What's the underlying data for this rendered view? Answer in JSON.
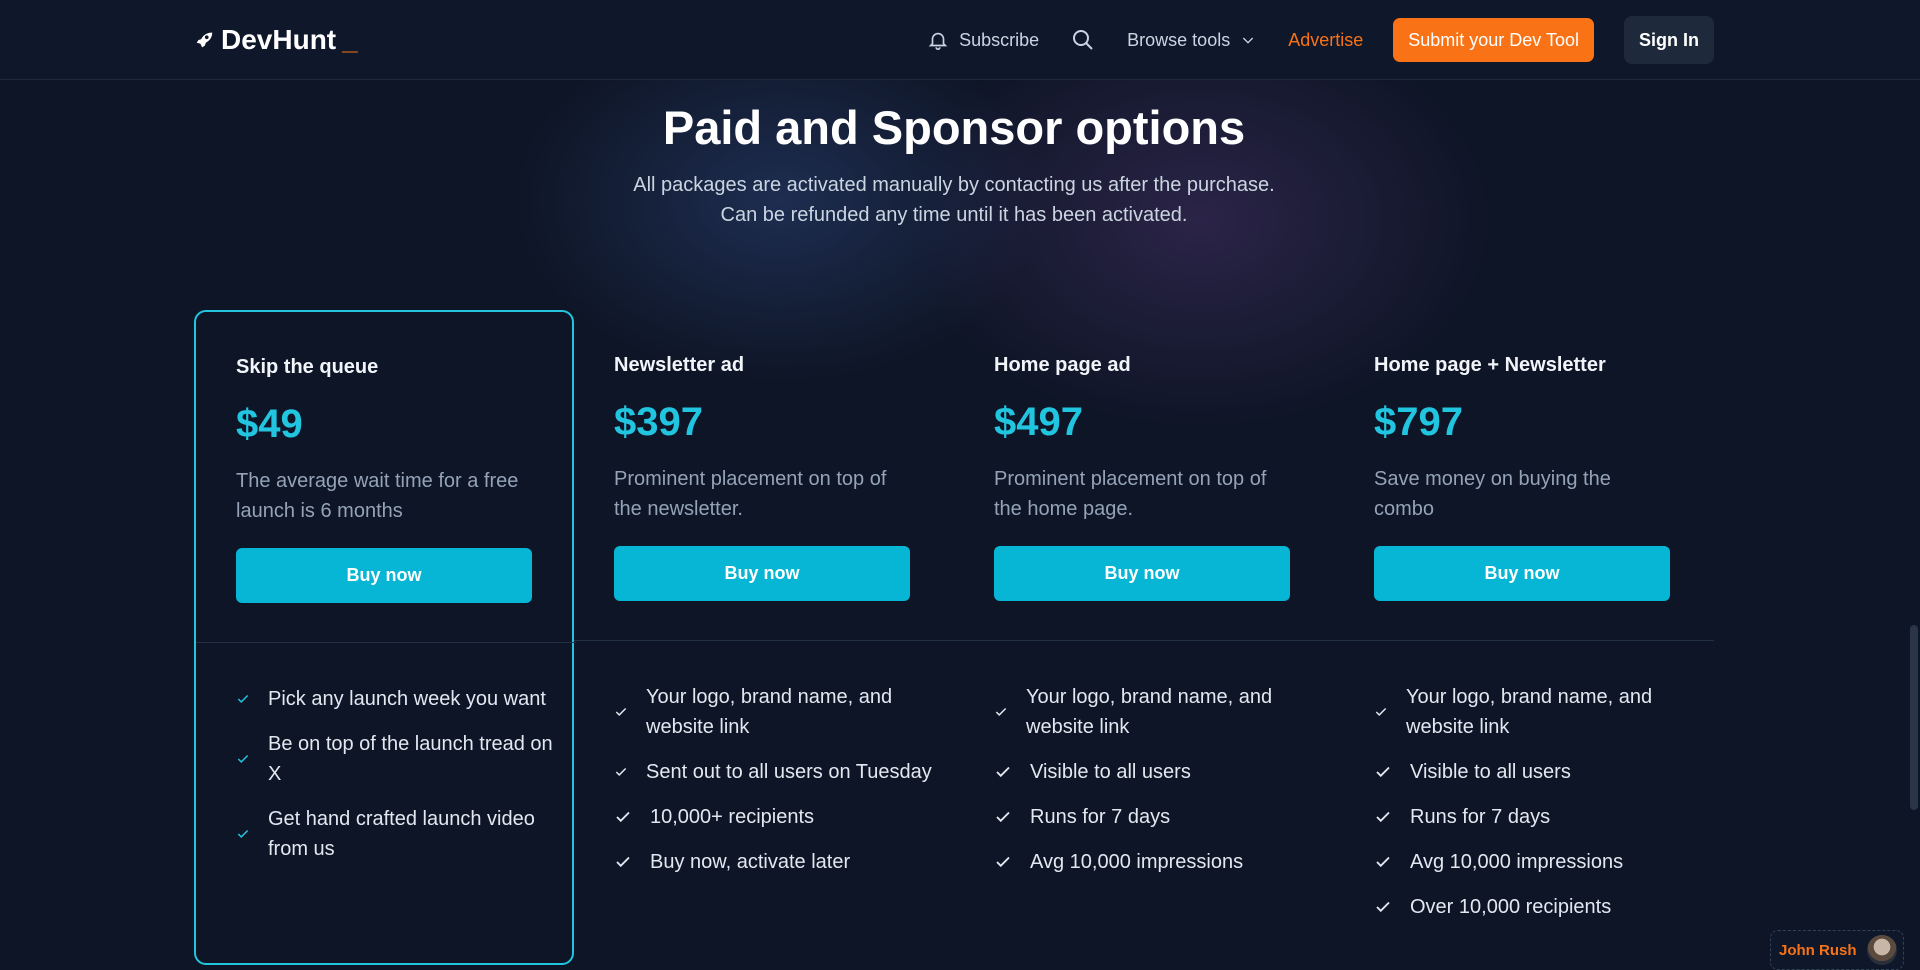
{
  "header": {
    "logo_text": "DevHunt",
    "logo_cursor": "_",
    "nav": {
      "subscribe": "Subscribe",
      "browse": "Browse tools",
      "advertise": "Advertise",
      "submit": "Submit your Dev Tool",
      "signin": "Sign In"
    }
  },
  "hero": {
    "title": "Paid and Sponsor options",
    "subtitle_line1": "All packages are activated manually by contacting us after the purchase.",
    "subtitle_line2": "Can be refunded any time until it has been activated."
  },
  "plans": [
    {
      "name": "Skip the queue",
      "price": "$49",
      "description": "The average wait time for a free launch is 6 months",
      "button": "Buy now",
      "featured": true,
      "features": [
        "Pick any launch week you want",
        "Be on top of the launch tread on X",
        "Get hand crafted launch video from us"
      ]
    },
    {
      "name": "Newsletter ad",
      "price": "$397",
      "description": "Prominent placement on top of the newsletter.",
      "button": "Buy now",
      "featured": false,
      "features": [
        "Your logo, brand name, and website link",
        "Sent out to all users on Tuesday",
        "10,000+ recipients",
        "Buy now, activate later"
      ]
    },
    {
      "name": "Home page ad",
      "price": "$497",
      "description": "Prominent placement on top of the home page.",
      "button": "Buy now",
      "featured": false,
      "features": [
        "Your logo, brand name, and website link",
        "Visible to all users",
        "Runs for 7 days",
        "Avg 10,000 impressions"
      ]
    },
    {
      "name": "Home page + Newsletter",
      "price": "$797",
      "description": "Save money on buying the combo",
      "button": "Buy now",
      "featured": false,
      "features": [
        "Your logo, brand name, and website link",
        "Visible to all users",
        "Runs for 7 days",
        "Avg 10,000 impressions",
        "Over 10,000 recipients"
      ]
    }
  ],
  "author_badge": {
    "name": "John Rush"
  },
  "colors": {
    "accent": "#22c5e0",
    "brand_orange": "#f97316",
    "background": "#0e1526"
  }
}
